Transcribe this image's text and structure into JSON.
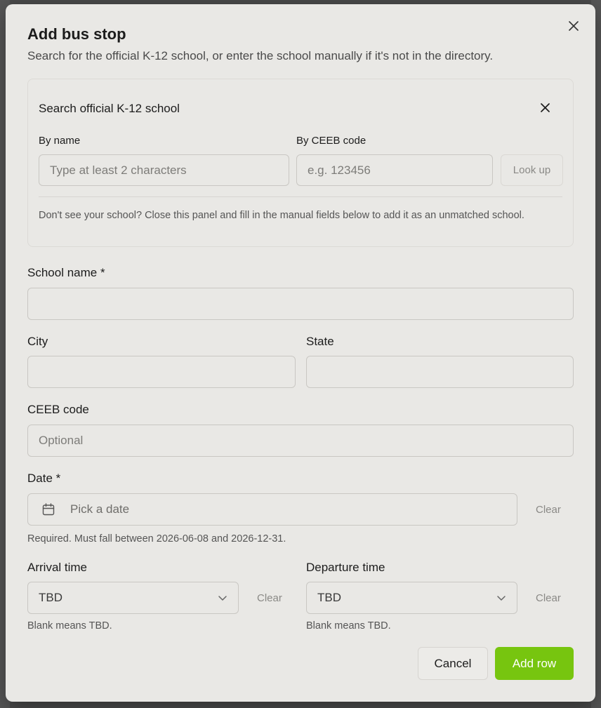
{
  "modal": {
    "title": "Add bus stop",
    "subtitle": "Search for the official K-12 school, or enter the school manually if it's not in the directory."
  },
  "search_panel": {
    "title": "Search official K-12 school",
    "by_name_label": "By name",
    "by_name_placeholder": "Type at least 2 characters",
    "by_ceeb_label": "By CEEB code",
    "by_ceeb_placeholder": "e.g. 123456",
    "lookup_label": "Look up",
    "note": "Don't see your school? Close this panel and fill in the manual fields below to add it as an unmatched school."
  },
  "form": {
    "school_name_label": "School name *",
    "school_name_value": "",
    "city_label": "City",
    "city_value": "",
    "state_label": "State",
    "state_value": "",
    "ceeb_label": "CEEB code",
    "ceeb_placeholder": "Optional",
    "date_label": "Date *",
    "date_placeholder": "Pick a date",
    "date_clear": "Clear",
    "date_hint": "Required. Must fall between 2026-06-08 and 2026-12-31.",
    "arrival_label": "Arrival time",
    "arrival_value": "TBD",
    "arrival_clear": "Clear",
    "arrival_hint": "Blank means TBD.",
    "departure_label": "Departure time",
    "departure_value": "TBD",
    "departure_clear": "Clear",
    "departure_hint": "Blank means TBD."
  },
  "actions": {
    "cancel_label": "Cancel",
    "add_label": "Add row"
  },
  "icons": {
    "close": "close-icon",
    "calendar": "calendar-icon",
    "chevron": "chevron-down-icon"
  },
  "colors": {
    "primary": "#77c50f",
    "modal_bg": "#e9e8e5"
  }
}
